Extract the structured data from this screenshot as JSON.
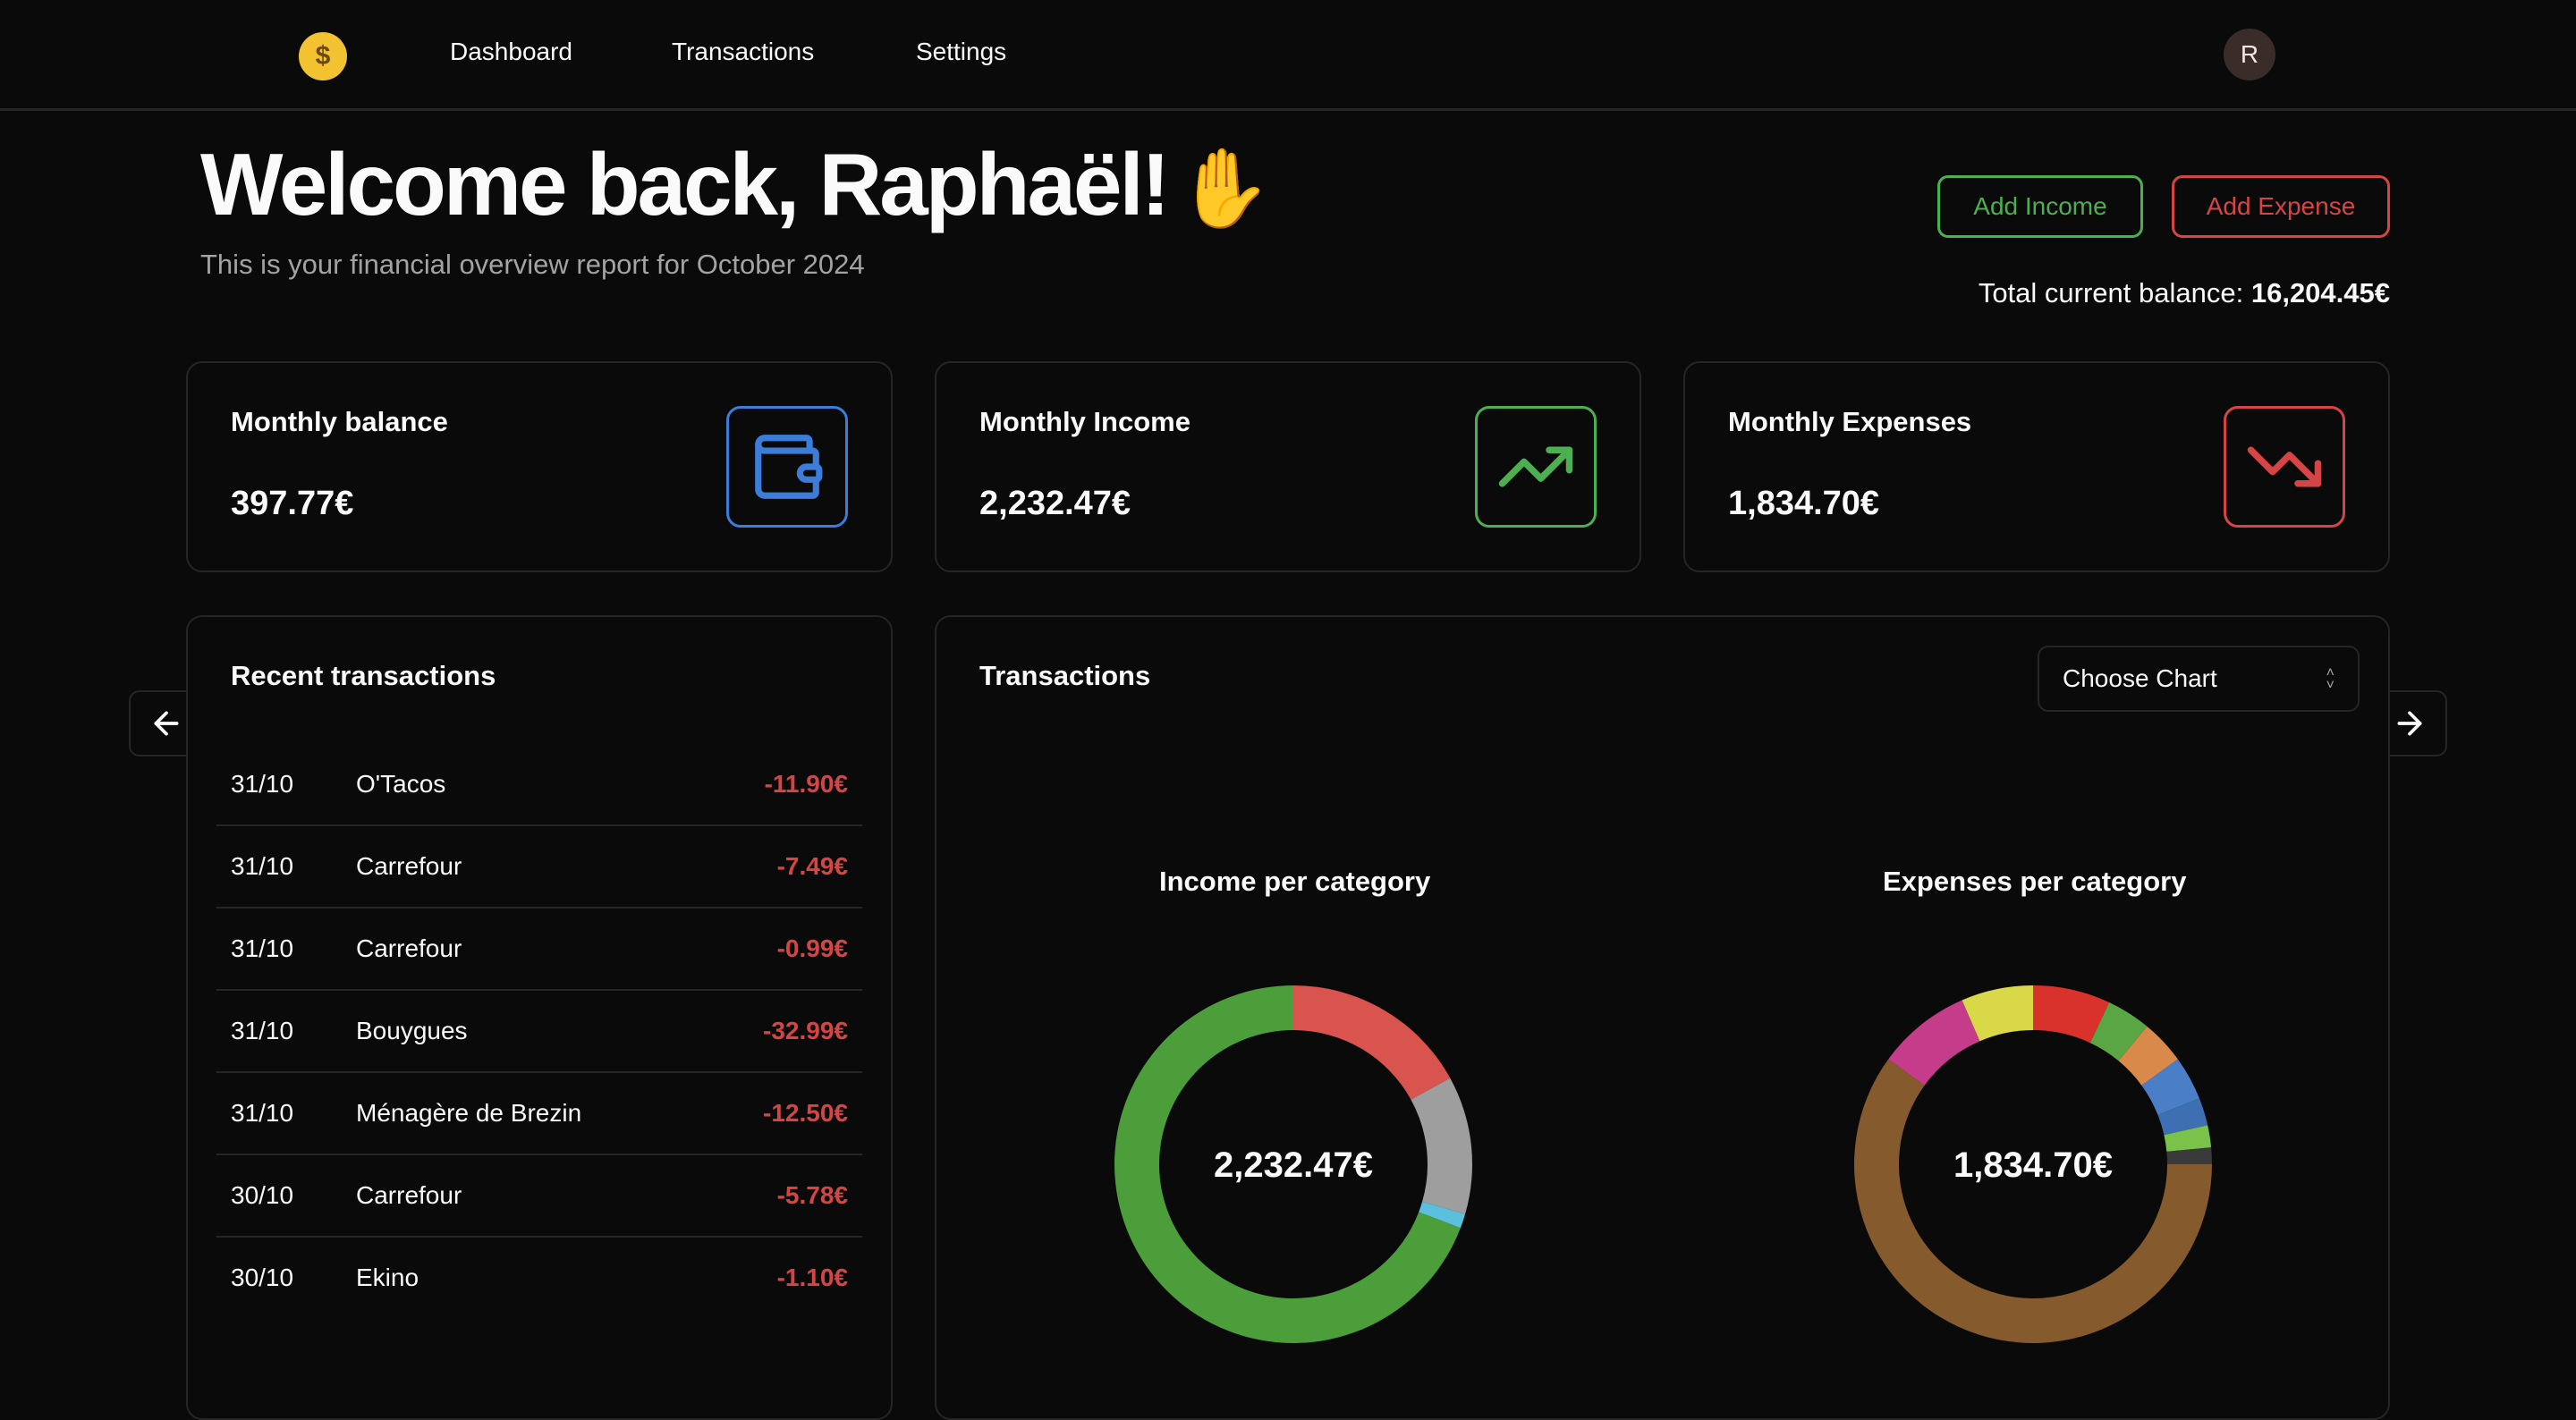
{
  "nav": {
    "logo_icon": "money-mouth-face-icon",
    "links": [
      "Dashboard",
      "Transactions",
      "Settings"
    ],
    "avatar_initial": "R"
  },
  "header": {
    "welcome": "Welcome back, Raphaël!",
    "wave_icon": "waving-hand-icon",
    "subtitle": "This is your financial overview report for October 2024",
    "add_income_label": "Add Income",
    "add_expense_label": "Add Expense",
    "balance_label": "Total current balance:",
    "balance_value": "16,204.45€"
  },
  "stats": [
    {
      "label": "Monthly balance",
      "value": "397.77€",
      "icon": "wallet-icon",
      "color": "#3b7dd8"
    },
    {
      "label": "Monthly Income",
      "value": "2,232.47€",
      "icon": "trending-up-icon",
      "color": "#4caf50"
    },
    {
      "label": "Monthly Expenses",
      "value": "1,834.70€",
      "icon": "trending-down-icon",
      "color": "#d64545"
    }
  ],
  "recent": {
    "title": "Recent transactions",
    "rows": [
      {
        "date": "31/10",
        "name": "O'Tacos",
        "amount": "-11.90€"
      },
      {
        "date": "31/10",
        "name": "Carrefour",
        "amount": "-7.49€"
      },
      {
        "date": "31/10",
        "name": "Carrefour",
        "amount": "-0.99€"
      },
      {
        "date": "31/10",
        "name": "Bouygues",
        "amount": "-32.99€"
      },
      {
        "date": "31/10",
        "name": "Ménagère de Brezin",
        "amount": "-12.50€"
      },
      {
        "date": "30/10",
        "name": "Carrefour",
        "amount": "-5.78€"
      },
      {
        "date": "30/10",
        "name": "Ekino",
        "amount": "-1.10€"
      }
    ]
  },
  "charts_panel": {
    "title": "Transactions",
    "select_label": "Choose Chart"
  },
  "chart_data": [
    {
      "type": "pie",
      "title": "Income per category",
      "center_label": "2,232.47€",
      "slices": [
        {
          "value": 17.0,
          "color": "#d9534f"
        },
        {
          "value": 12.5,
          "color": "#9e9e9e"
        },
        {
          "value": 1.3,
          "color": "#5bc0de"
        },
        {
          "value": 69.2,
          "color": "#4c9e3b"
        }
      ]
    },
    {
      "type": "pie",
      "title": "Expenses per category",
      "center_label": "1,834.70€",
      "slices": [
        {
          "value": 7.0,
          "color": "#d9312b"
        },
        {
          "value": 4.0,
          "color": "#5aa644"
        },
        {
          "value": 4.0,
          "color": "#d9894a"
        },
        {
          "value": 4.0,
          "color": "#4a7fc8"
        },
        {
          "value": 2.5,
          "color": "#3f6fb3"
        },
        {
          "value": 2.0,
          "color": "#7ac24a"
        },
        {
          "value": 1.5,
          "color": "#3a3a3a"
        },
        {
          "value": 60.0,
          "color": "#855a2c"
        },
        {
          "value": 8.5,
          "color": "#c53d8a"
        },
        {
          "value": 6.5,
          "color": "#d8d848"
        }
      ]
    }
  ]
}
